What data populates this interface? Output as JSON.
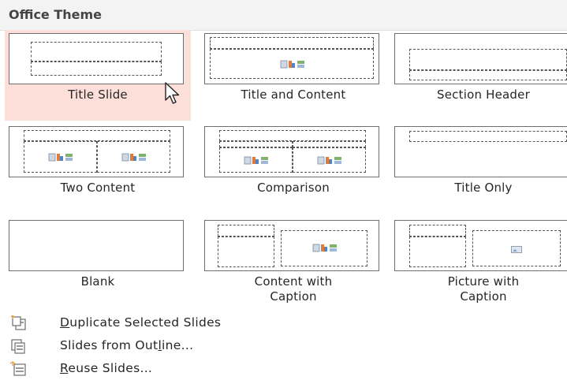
{
  "header": {
    "title": "Office Theme"
  },
  "layouts": [
    {
      "label": "Title Slide",
      "selected": true
    },
    {
      "label": "Title and Content"
    },
    {
      "label": "Section Header"
    },
    {
      "label": "Two Content"
    },
    {
      "label": "Comparison"
    },
    {
      "label": "Title Only"
    },
    {
      "label": "Blank"
    },
    {
      "label": "Content with\nCaption"
    },
    {
      "label": "Picture with\nCaption"
    }
  ],
  "menu": [
    {
      "label": "Duplicate Selected Slides",
      "mnemonic": "D",
      "icon": "duplicate-slides-icon"
    },
    {
      "label": "Slides from Outline...",
      "mnemonic": "l",
      "icon": "outline-slides-icon"
    },
    {
      "label": "Reuse Slides...",
      "mnemonic": "R",
      "icon": "reuse-slides-icon"
    }
  ],
  "colors": {
    "selected_bg": "#fcdfd8",
    "header_bg": "#f3f3f3"
  }
}
